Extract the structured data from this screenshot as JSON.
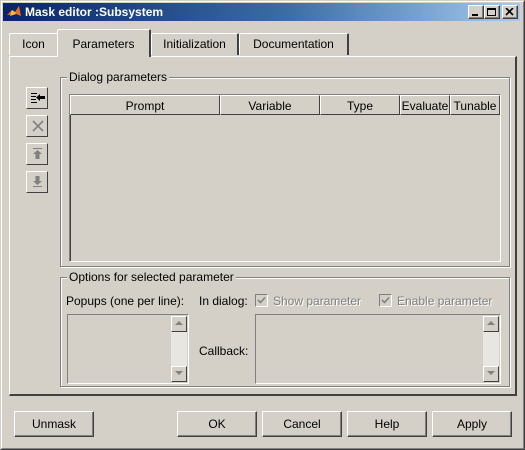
{
  "window": {
    "title": "Mask editor :Subsystem",
    "colors": {
      "face": "#d4d0c8",
      "title_start": "#0a246a",
      "title_end": "#a6caf0",
      "disabled_text": "#808080"
    }
  },
  "caption_buttons": {
    "minimize": "minimize-icon",
    "maximize": "maximize-icon",
    "close": "close-icon"
  },
  "tabs": [
    {
      "label": "Icon",
      "active": false
    },
    {
      "label": "Parameters",
      "active": true
    },
    {
      "label": "Initialization",
      "active": false
    },
    {
      "label": "Documentation",
      "active": false
    }
  ],
  "dialog_parameters": {
    "group_label": "Dialog parameters",
    "columns": [
      "Prompt",
      "Variable",
      "Type",
      "Evaluate",
      "Tunable"
    ],
    "rows": []
  },
  "side_toolbar": [
    {
      "icon": "add-parameter-icon",
      "enabled": true
    },
    {
      "icon": "delete-icon",
      "enabled": false
    },
    {
      "icon": "move-up-icon",
      "enabled": false
    },
    {
      "icon": "move-down-icon",
      "enabled": false
    }
  ],
  "options": {
    "group_label": "Options for selected parameter",
    "popups_label": "Popups (one per line):",
    "in_dialog_label": "In dialog:",
    "show_parameter_label": "Show parameter",
    "show_parameter_checked": true,
    "enable_parameter_label": "Enable parameter",
    "enable_parameter_checked": true,
    "callback_label": "Callback:",
    "popups_value": "",
    "callback_value": ""
  },
  "buttons": {
    "unmask": "Unmask",
    "ok": "OK",
    "cancel": "Cancel",
    "help": "Help",
    "apply": "Apply"
  }
}
